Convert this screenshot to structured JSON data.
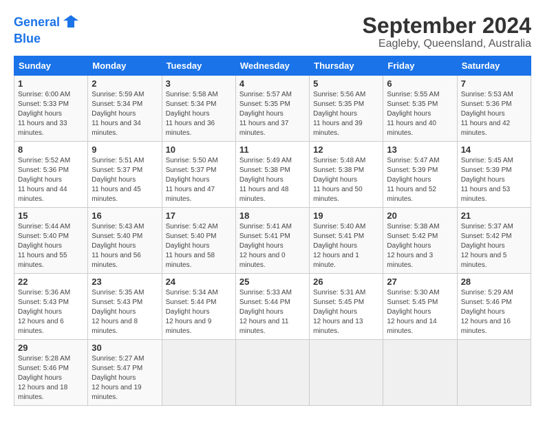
{
  "header": {
    "logo_line1": "General",
    "logo_line2": "Blue",
    "title": "September 2024",
    "subtitle": "Eagleby, Queensland, Australia"
  },
  "calendar": {
    "days_of_week": [
      "Sunday",
      "Monday",
      "Tuesday",
      "Wednesday",
      "Thursday",
      "Friday",
      "Saturday"
    ],
    "weeks": [
      [
        null,
        {
          "day": 2,
          "sunrise": "5:59 AM",
          "sunset": "5:34 PM",
          "daylight": "11 hours and 34 minutes."
        },
        {
          "day": 3,
          "sunrise": "5:58 AM",
          "sunset": "5:34 PM",
          "daylight": "11 hours and 36 minutes."
        },
        {
          "day": 4,
          "sunrise": "5:57 AM",
          "sunset": "5:35 PM",
          "daylight": "11 hours and 37 minutes."
        },
        {
          "day": 5,
          "sunrise": "5:56 AM",
          "sunset": "5:35 PM",
          "daylight": "11 hours and 39 minutes."
        },
        {
          "day": 6,
          "sunrise": "5:55 AM",
          "sunset": "5:35 PM",
          "daylight": "11 hours and 40 minutes."
        },
        {
          "day": 7,
          "sunrise": "5:53 AM",
          "sunset": "5:36 PM",
          "daylight": "11 hours and 42 minutes."
        }
      ],
      [
        {
          "day": 1,
          "sunrise": "6:00 AM",
          "sunset": "5:33 PM",
          "daylight": "11 hours and 33 minutes."
        },
        null,
        null,
        null,
        null,
        null,
        null
      ],
      [
        {
          "day": 8,
          "sunrise": "5:52 AM",
          "sunset": "5:36 PM",
          "daylight": "11 hours and 44 minutes."
        },
        {
          "day": 9,
          "sunrise": "5:51 AM",
          "sunset": "5:37 PM",
          "daylight": "11 hours and 45 minutes."
        },
        {
          "day": 10,
          "sunrise": "5:50 AM",
          "sunset": "5:37 PM",
          "daylight": "11 hours and 47 minutes."
        },
        {
          "day": 11,
          "sunrise": "5:49 AM",
          "sunset": "5:38 PM",
          "daylight": "11 hours and 48 minutes."
        },
        {
          "day": 12,
          "sunrise": "5:48 AM",
          "sunset": "5:38 PM",
          "daylight": "11 hours and 50 minutes."
        },
        {
          "day": 13,
          "sunrise": "5:47 AM",
          "sunset": "5:39 PM",
          "daylight": "11 hours and 52 minutes."
        },
        {
          "day": 14,
          "sunrise": "5:45 AM",
          "sunset": "5:39 PM",
          "daylight": "11 hours and 53 minutes."
        }
      ],
      [
        {
          "day": 15,
          "sunrise": "5:44 AM",
          "sunset": "5:40 PM",
          "daylight": "11 hours and 55 minutes."
        },
        {
          "day": 16,
          "sunrise": "5:43 AM",
          "sunset": "5:40 PM",
          "daylight": "11 hours and 56 minutes."
        },
        {
          "day": 17,
          "sunrise": "5:42 AM",
          "sunset": "5:40 PM",
          "daylight": "11 hours and 58 minutes."
        },
        {
          "day": 18,
          "sunrise": "5:41 AM",
          "sunset": "5:41 PM",
          "daylight": "12 hours and 0 minutes."
        },
        {
          "day": 19,
          "sunrise": "5:40 AM",
          "sunset": "5:41 PM",
          "daylight": "12 hours and 1 minute."
        },
        {
          "day": 20,
          "sunrise": "5:38 AM",
          "sunset": "5:42 PM",
          "daylight": "12 hours and 3 minutes."
        },
        {
          "day": 21,
          "sunrise": "5:37 AM",
          "sunset": "5:42 PM",
          "daylight": "12 hours and 5 minutes."
        }
      ],
      [
        {
          "day": 22,
          "sunrise": "5:36 AM",
          "sunset": "5:43 PM",
          "daylight": "12 hours and 6 minutes."
        },
        {
          "day": 23,
          "sunrise": "5:35 AM",
          "sunset": "5:43 PM",
          "daylight": "12 hours and 8 minutes."
        },
        {
          "day": 24,
          "sunrise": "5:34 AM",
          "sunset": "5:44 PM",
          "daylight": "12 hours and 9 minutes."
        },
        {
          "day": 25,
          "sunrise": "5:33 AM",
          "sunset": "5:44 PM",
          "daylight": "12 hours and 11 minutes."
        },
        {
          "day": 26,
          "sunrise": "5:31 AM",
          "sunset": "5:45 PM",
          "daylight": "12 hours and 13 minutes."
        },
        {
          "day": 27,
          "sunrise": "5:30 AM",
          "sunset": "5:45 PM",
          "daylight": "12 hours and 14 minutes."
        },
        {
          "day": 28,
          "sunrise": "5:29 AM",
          "sunset": "5:46 PM",
          "daylight": "12 hours and 16 minutes."
        }
      ],
      [
        {
          "day": 29,
          "sunrise": "5:28 AM",
          "sunset": "5:46 PM",
          "daylight": "12 hours and 18 minutes."
        },
        {
          "day": 30,
          "sunrise": "5:27 AM",
          "sunset": "5:47 PM",
          "daylight": "12 hours and 19 minutes."
        },
        null,
        null,
        null,
        null,
        null
      ]
    ]
  }
}
